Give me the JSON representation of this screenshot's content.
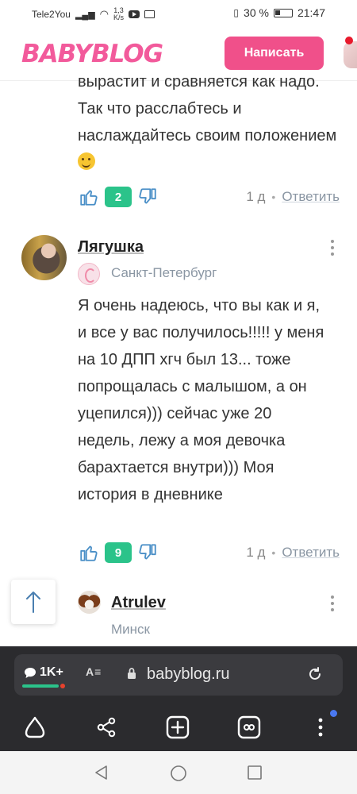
{
  "statusbar": {
    "carrier": "Tele2You",
    "speed": "1,3\nK/s",
    "battery": "30 %",
    "time": "21:47"
  },
  "header": {
    "logo": "BABYBLOG",
    "write_label": "Написать"
  },
  "prev_comment": {
    "text": "вырастит и сравняется как надо. Так что расслабтесь и наслаждайтесь своим положением",
    "likes": "2",
    "time": "1 д",
    "reply": "Ответить"
  },
  "comment": {
    "username": "Лягушка",
    "city": "Санкт-Петербург",
    "text": "Я очень надеюсь, что вы как и я, и все у вас получилось!!!!! у меня на 10 ДПП хгч был 13... тоже попрощалась с малышом, а он уцепился))) сейчас уже 20 недель, лежу а моя девочка барахтается внутри))) Моя история в дневнике",
    "likes": "9",
    "time": "1 д",
    "reply": "Ответить"
  },
  "next_comment": {
    "username": "Atrulev",
    "city": "Минск"
  },
  "browser": {
    "comments_count": "1K+",
    "reader_label": "A̲≡",
    "url": "babyblog.ru"
  },
  "colors": {
    "brand_pink": "#f25a9b",
    "button_pink": "#f0508a",
    "likes_green": "#2bc38a",
    "link_gray": "#8a96a3"
  }
}
